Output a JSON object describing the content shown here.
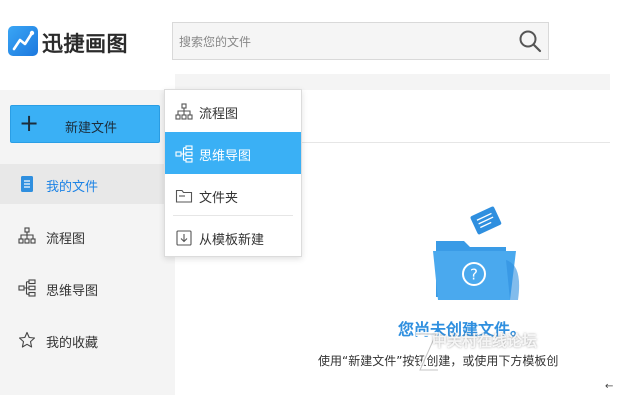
{
  "app": {
    "name": "迅捷画图"
  },
  "search": {
    "placeholder": "搜索您的文件"
  },
  "sidebar": {
    "new_button_label": "新建文件",
    "items": [
      {
        "label": "我的文件",
        "icon": "document-icon",
        "active": true
      },
      {
        "label": "流程图",
        "icon": "flowchart-icon"
      },
      {
        "label": "思维导图",
        "icon": "mindmap-icon"
      },
      {
        "label": "我的收藏",
        "icon": "star-icon"
      }
    ]
  },
  "new_menu": {
    "items": [
      {
        "label": "流程图",
        "icon": "flowchart-icon"
      },
      {
        "label": "思维导图",
        "icon": "mindmap-icon",
        "active": true
      },
      {
        "label": "文件夹",
        "icon": "folder-icon"
      },
      {
        "label": "从模板新建",
        "icon": "template-icon"
      }
    ]
  },
  "empty_state": {
    "title": "您尚未创建文件。",
    "hint": "使用“新建文件”按钮创建，或使用下方模板创"
  },
  "watermark": {
    "text": "中关村在线论坛"
  },
  "colors": {
    "accent": "#3ab0f5",
    "accent_text": "#1d83e5",
    "title_blue": "#2f8fdf"
  }
}
